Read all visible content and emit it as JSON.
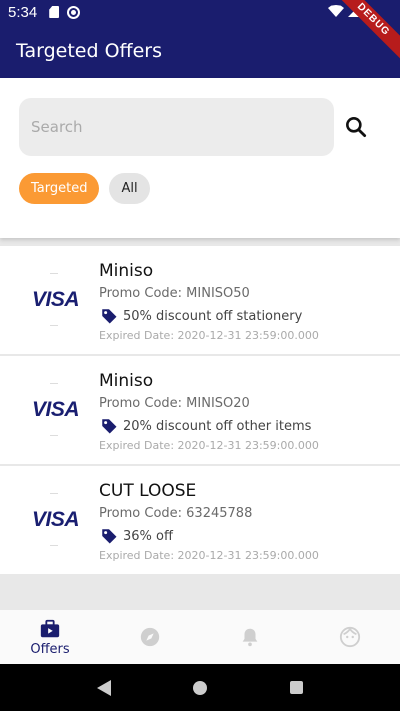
{
  "status_bar": {
    "time": "5:34"
  },
  "debug_ribbon": "DEBUG",
  "app_bar": {
    "title": "Targeted Offers"
  },
  "search": {
    "placeholder": "Search"
  },
  "filters": [
    {
      "label": "Targeted",
      "active": true
    },
    {
      "label": "All",
      "active": false
    }
  ],
  "offers": [
    {
      "logo": "VISA",
      "merchant": "Miniso",
      "promo": "Promo Code: MINISO50",
      "discount": "50% discount off stationery",
      "expiry": "Expired Date: 2020-12-31 23:59:00.000"
    },
    {
      "logo": "VISA",
      "merchant": "Miniso",
      "promo": "Promo Code: MINISO20",
      "discount": "20% discount off other items",
      "expiry": "Expired Date: 2020-12-31 23:59:00.000"
    },
    {
      "logo": "VISA",
      "merchant": "CUT LOOSE",
      "promo": "Promo Code: 63245788",
      "discount": "36% off",
      "expiry": "Expired Date: 2020-12-31 23:59:00.000"
    }
  ],
  "bottom_nav": {
    "items": [
      {
        "label": "Offers",
        "icon": "briefcase-icon",
        "active": true
      },
      {
        "label": "",
        "icon": "compass-icon",
        "active": false
      },
      {
        "label": "",
        "icon": "bell-icon",
        "active": false
      },
      {
        "label": "",
        "icon": "face-icon",
        "active": false
      }
    ]
  },
  "colors": {
    "primary": "#1a1d6e",
    "accent": "#fb9a34",
    "visa_blue": "#1a1f71",
    "inactive_icon": "#cfcfcf"
  }
}
